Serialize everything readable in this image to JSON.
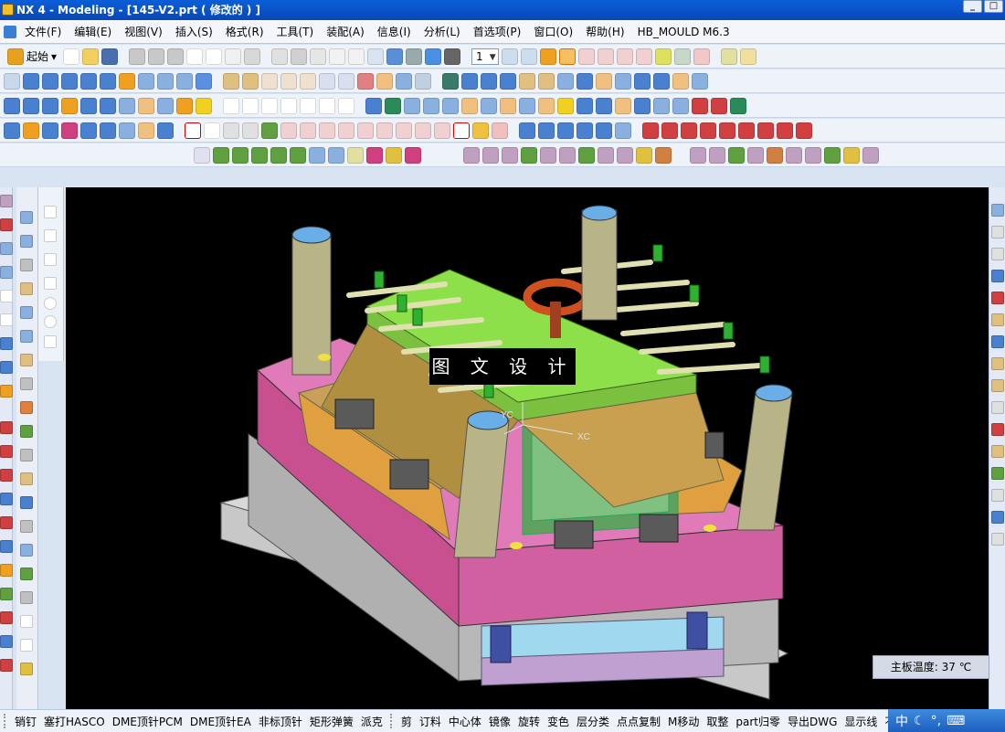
{
  "window": {
    "title": "NX 4 - Modeling - [145-V2.prt ( 修改的 ) ]",
    "buttons": [
      "_",
      "□"
    ]
  },
  "menu": {
    "items": [
      "文件(F)",
      "编辑(E)",
      "视图(V)",
      "插入(S)",
      "格式(R)",
      "工具(T)",
      "装配(A)",
      "信息(I)",
      "分析(L)",
      "首选项(P)",
      "窗口(O)",
      "帮助(H)",
      "HB_MOULD M6.3"
    ]
  },
  "toolbar": {
    "start_label": "起始",
    "layer_value": "1"
  },
  "viewport": {
    "watermark": "图 文 设 计",
    "axis_labels": [
      "YC",
      "XC"
    ],
    "temp_label": "主板温度: 37 ℃"
  },
  "statusbar": {
    "items": [
      "销钉",
      "塞打HASCO",
      "DME顶针PCM",
      "DME顶针EA",
      "非标顶针",
      "矩形弹簧",
      "派克"
    ],
    "items2": [
      "剪",
      "订料",
      "中心体",
      "镜像",
      "旋转",
      "变色",
      "层分类",
      "点点复制",
      "M移动",
      "取整",
      "part归零",
      "导出DWG",
      "显示线",
      "不显"
    ],
    "tray_text": "中"
  },
  "colors": {
    "title_bar": "#0747b8",
    "mold_green": "#8ee04a",
    "mold_pink": "#e07ab8",
    "mold_tan": "#c8a05a",
    "mold_gray": "#b8b8b8",
    "pillar": "#b8b488",
    "background": "#000000"
  }
}
